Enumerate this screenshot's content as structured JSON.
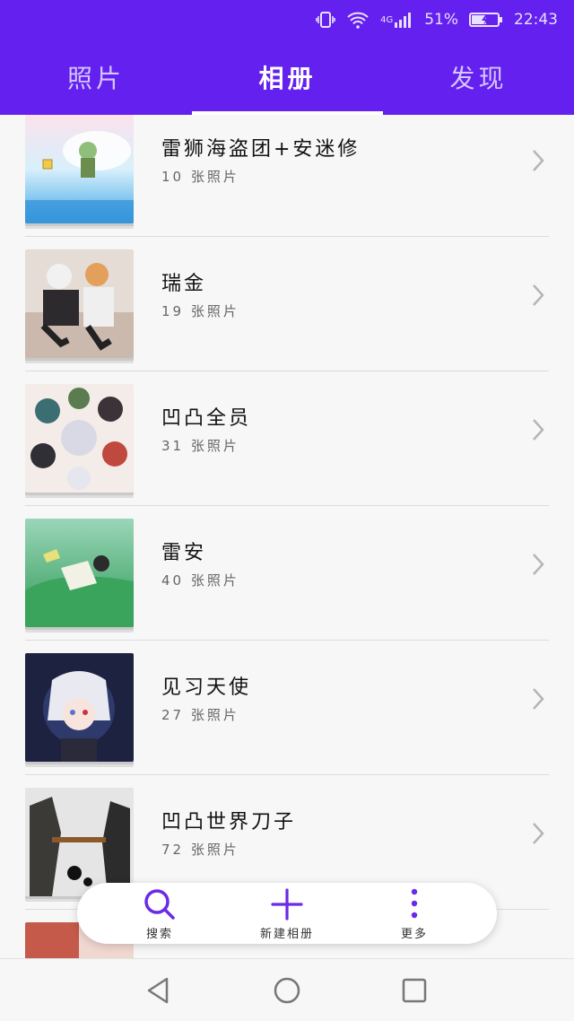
{
  "status_bar": {
    "network": "4G",
    "battery": "51%",
    "time": "22:43"
  },
  "tabs": [
    {
      "label": "照片",
      "active": false
    },
    {
      "label": "相册",
      "active": true
    },
    {
      "label": "发现",
      "active": false
    }
  ],
  "albums": [
    {
      "name": "雷狮海盗团+安迷修",
      "count": "10 张照片"
    },
    {
      "name": "瑞金",
      "count": "19 张照片"
    },
    {
      "name": "凹凸全员",
      "count": "31 张照片"
    },
    {
      "name": "雷安",
      "count": "40 张照片"
    },
    {
      "name": "见习天使",
      "count": "27 张照片"
    },
    {
      "name": "凹凸世界刀子",
      "count": "72 张照片"
    }
  ],
  "actions": [
    {
      "label": "搜索",
      "icon": "search-icon"
    },
    {
      "label": "新建相册",
      "icon": "plus-icon"
    },
    {
      "label": "更多",
      "icon": "more-vertical-icon"
    }
  ],
  "nav": {
    "back_icon": "back-triangle-icon",
    "home_icon": "home-circle-icon",
    "recents_icon": "recents-square-icon"
  },
  "colors": {
    "accent": "#6420ee",
    "tab_inactive": "#d6c6ff",
    "action_icon": "#6a2ae6"
  }
}
